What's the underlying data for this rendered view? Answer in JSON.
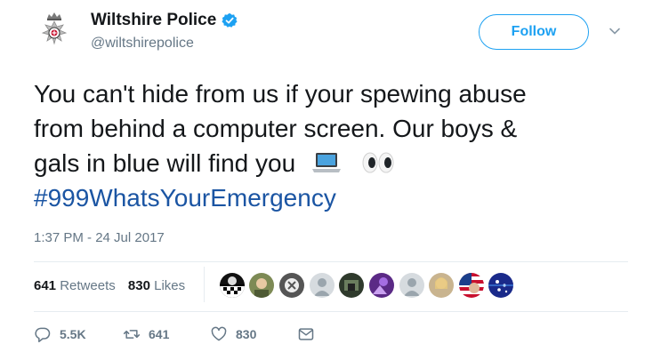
{
  "account": {
    "name": "Wiltshire Police",
    "handle": "@wiltshirepolice"
  },
  "follow_label": "Follow",
  "tweet": {
    "line1": "You can't hide from us if your spewing abuse",
    "line2": "from behind a computer screen. Our boys &",
    "line3": "gals in blue will find you",
    "hashtag": "#999WhatsYourEmergency"
  },
  "timestamp": "1:37 PM - 24 Jul 2017",
  "stats": {
    "retweets_count": "641",
    "retweets_label": "Retweets",
    "likes_count": "830",
    "likes_label": "Likes"
  },
  "actions": {
    "replies": "5.5K",
    "retweets": "641",
    "likes": "830"
  },
  "icons": [
    "police-crest-icon",
    "verified-badge-icon",
    "chevron-down-icon",
    "laptop-emoji-icon",
    "eyes-emoji-icon",
    "reply-icon",
    "retweet-icon",
    "like-icon",
    "message-icon"
  ],
  "colors": {
    "link": "#1b55a3",
    "follow": "#1da1f2",
    "muted": "#657786",
    "text": "#14171a"
  }
}
